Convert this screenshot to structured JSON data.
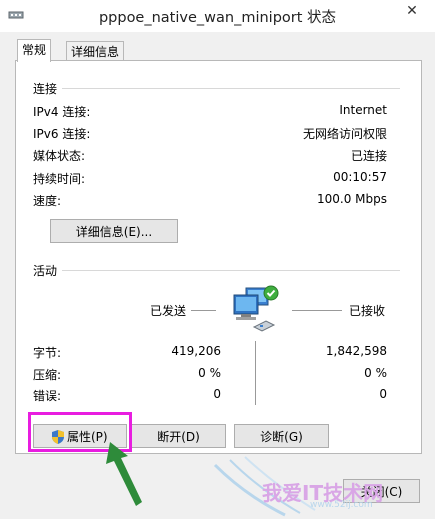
{
  "window": {
    "title": "pppoe_native_wan_miniport 状态",
    "close_label": "✕"
  },
  "tabs": [
    {
      "label": "常规"
    },
    {
      "label": "详细信息"
    }
  ],
  "connection": {
    "section_title": "连接",
    "rows": [
      {
        "label": "IPv4 连接:",
        "value": "Internet"
      },
      {
        "label": "IPv6 连接:",
        "value": "无网络访问权限"
      },
      {
        "label": "媒体状态:",
        "value": "已连接"
      },
      {
        "label": "持续时间:",
        "value": "00:10:57"
      },
      {
        "label": "速度:",
        "value": "100.0 Mbps"
      }
    ],
    "details_button": "详细信息(E)..."
  },
  "activity": {
    "section_title": "活动",
    "sent_label": "已发送",
    "received_label": "已接收",
    "stats": [
      {
        "label": "字节:",
        "sent": "419,206",
        "received": "1,842,598"
      },
      {
        "label": "压缩:",
        "sent": "0 %",
        "received": "0 %"
      },
      {
        "label": "错误:",
        "sent": "0",
        "received": "0"
      }
    ]
  },
  "buttons": {
    "properties": "属性(P)",
    "disconnect": "断开(D)",
    "diagnose": "诊断(G)",
    "close": "关闭(C)"
  },
  "watermark": {
    "text": "我爱IT技术网",
    "url": "www.52ij.com"
  },
  "colors": {
    "highlight_border": "#e81de0",
    "arrow": "#2e8b3a",
    "background": "#4a9fd6"
  },
  "icons": {
    "title": "network-adapter-icon",
    "activity": "network-computers-icon",
    "shield": "uac-shield-icon"
  }
}
